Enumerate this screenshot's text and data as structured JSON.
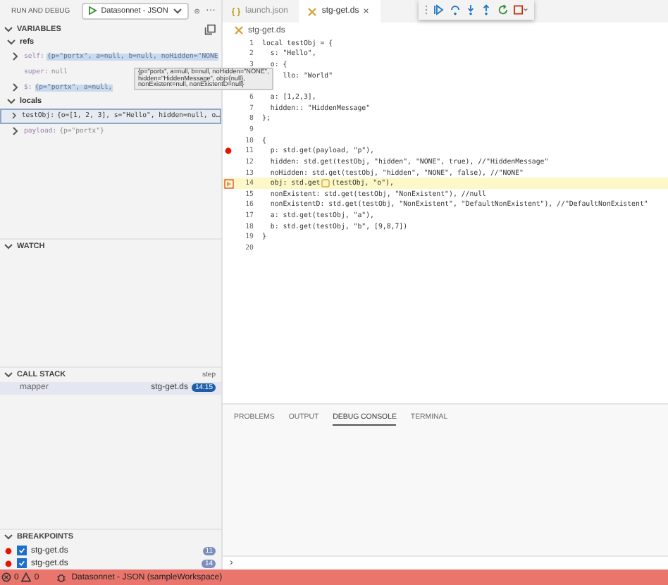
{
  "sidebar": {
    "title": "RUN AND DEBUG",
    "config": "Datasonnet - JSON",
    "more": "···",
    "variables": {
      "title": "VARIABLES",
      "scopes": [
        {
          "name": "refs",
          "expanded": true,
          "vars": [
            {
              "name": "self:",
              "value": "{p=\"portx\", a=null, b=null, noHidden=\"NONE",
              "expandable": true,
              "dimmed": true,
              "highlighted": true,
              "selected": false
            },
            {
              "name": "super:",
              "value": "null",
              "expandable": false,
              "dimmed": true,
              "highlighted": false,
              "selected": false
            },
            {
              "name": "$:",
              "value": "{p=\"portx\", a=null,",
              "expandable": true,
              "dimmed": true,
              "highlighted": true,
              "selected": false
            }
          ]
        },
        {
          "name": "locals",
          "expanded": true,
          "vars": [
            {
              "name": "testObj:",
              "value": "{o=[1, 2, 3], s=\"Hello\", hidden=null, o…",
              "expandable": true,
              "dimmed": false,
              "highlighted": false,
              "selected": true
            },
            {
              "name": "payload:",
              "value": "{p=\"portx\"}",
              "expandable": true,
              "dimmed": true,
              "highlighted": false,
              "selected": false
            }
          ]
        }
      ],
      "tooltip": [
        "{p=\"portx\", a=null, b=null, noHidden=\"NONE\",",
        "hidden=\"HiddenMessage\", obj={null},",
        "nonExistent=null, nonExistentD=null}"
      ]
    },
    "watch": {
      "title": "WATCH"
    },
    "call_stack": {
      "title": "CALL STACK",
      "status": "step",
      "frames": [
        {
          "name": "mapper",
          "file": "stg-get.ds",
          "position": "14:15",
          "selected": true
        }
      ]
    },
    "breakpoints": {
      "title": "BREAKPOINTS",
      "items": [
        {
          "file": "stg-get.ds",
          "checked": true,
          "line": "11"
        },
        {
          "file": "stg-get.ds",
          "checked": true,
          "line": "14"
        }
      ]
    }
  },
  "editor": {
    "tabs": [
      {
        "label": "launch.json",
        "kind": "json",
        "selected": false
      },
      {
        "label": "stg-get.ds",
        "kind": "ds",
        "selected": true,
        "close": "×"
      }
    ],
    "breadcrumb": "stg-get.ds",
    "lines": [
      {
        "number": "1",
        "text": "local testObj = {",
        "breakpoint": false,
        "current": false
      },
      {
        "number": "2",
        "text": "  s: \"Hello\",",
        "breakpoint": false,
        "current": false
      },
      {
        "number": "3",
        "text": "  o: {",
        "breakpoint": false,
        "current": false
      },
      {
        "text": "     llo: \"World\"",
        "current": false
      },
      {
        "current": false
      },
      {
        "number": "6",
        "text": "  a: [1,2,3],",
        "breakpoint": false,
        "current": false
      },
      {
        "number": "7",
        "text": "  hidden:: \"HiddenMessage\"",
        "breakpoint": false,
        "current": false
      },
      {
        "number": "8",
        "text": "};",
        "breakpoint": false,
        "current": false
      },
      {
        "number": "9",
        "breakpoint": false,
        "current": false
      },
      {
        "number": "10",
        "text": "{",
        "breakpoint": false,
        "current": false
      },
      {
        "number": "11",
        "text": "  p: std.get(payload, \"p\"),",
        "breakpoint": true,
        "current": false
      },
      {
        "number": "12",
        "text": "  hidden: std.get(testObj, \"hidden\", \"NONE\", true), //\"HiddenMessage\"",
        "breakpoint": false,
        "current": false
      },
      {
        "number": "13",
        "text": "  noHidden: std.get(testObj, \"hidden\", \"NONE\", false), //\"NONE\"",
        "breakpoint": false,
        "current": false
      },
      {
        "number": "14",
        "text": "  obj: std.get",
        "after": "(testObj, \"o\"),",
        "breakpoint": true,
        "current": true
      },
      {
        "number": "15",
        "text": "  nonExistent: std.get(testObj, \"NonExistent\"), //null",
        "breakpoint": false,
        "current": false
      },
      {
        "number": "16",
        "text": "  nonExistentD: std.get(testObj, \"NonExistent\", \"DefaultNonExistent\"), //\"DefaultNonExistent\"",
        "breakpoint": false,
        "current": false
      },
      {
        "number": "17",
        "text": "  a: std.get(testObj, \"a\"),",
        "breakpoint": false,
        "current": false
      },
      {
        "number": "18",
        "text": "  b: std.get(testObj, \"b\", [9,8,7])",
        "breakpoint": false,
        "current": false
      },
      {
        "number": "19",
        "text": "}",
        "breakpoint": false,
        "current": false
      },
      {
        "number": "20",
        "breakpoint": false,
        "current": false
      }
    ]
  },
  "panel": {
    "tabs": [
      {
        "label": "PROBLEMS",
        "selected": false
      },
      {
        "label": "OUTPUT",
        "selected": false
      },
      {
        "label": "DEBUG CONSOLE",
        "selected": true
      },
      {
        "label": "TERMINAL",
        "selected": false
      }
    ],
    "prompt": "›"
  },
  "status_bar": {
    "errors": "0",
    "warnings": "0",
    "target": "Datasonnet - JSON (sampleWorkspace)"
  }
}
